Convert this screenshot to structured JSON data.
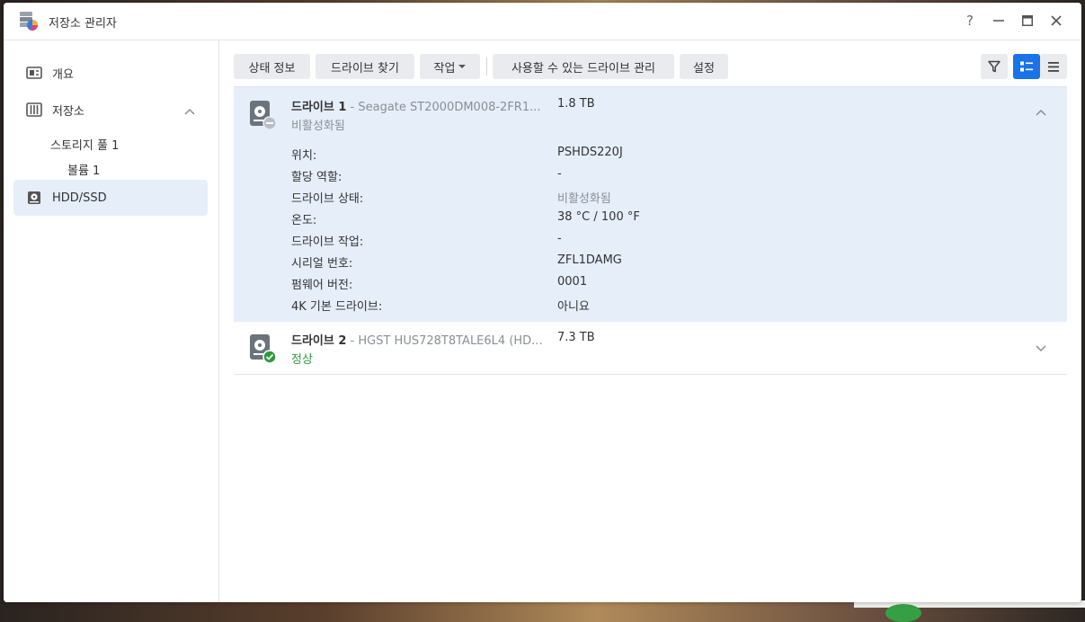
{
  "window": {
    "title": "저장소 관리자",
    "controls": {
      "help": "?",
      "minimize": "—",
      "maximize": "▭",
      "close": "✕"
    }
  },
  "sidebar": {
    "items": [
      {
        "label": "개요",
        "icon": "overview-icon"
      },
      {
        "label": "저장소",
        "icon": "storage-icon"
      },
      {
        "label": "HDD/SSD",
        "icon": "hdd-icon"
      }
    ],
    "sub_items": [
      {
        "label": "스토리지 풀 1"
      },
      {
        "label": "볼륨 1"
      }
    ]
  },
  "toolbar": {
    "status_info": "상태 정보",
    "find_drive": "드라이브 찾기",
    "action": "작업",
    "manage_available": "사용할 수 있는 드라이브 관리",
    "settings": "설정"
  },
  "drives": [
    {
      "name": "드라이브 1",
      "model": " - Seagate ST2000DM008-2FR1...",
      "size": "1.8 TB",
      "status": "비활성화됨",
      "details": [
        {
          "label": "위치:",
          "value": "PSHDS220J"
        },
        {
          "label": "할당 역할:",
          "value": "-"
        },
        {
          "label": "드라이브 상태:",
          "value": "비활성화됨"
        },
        {
          "label": "온도:",
          "value": "38 °C / 100 °F"
        },
        {
          "label": "드라이브 작업:",
          "value": "-"
        },
        {
          "label": "시리얼 번호:",
          "value": "ZFL1DAMG"
        },
        {
          "label": "펌웨어 버전:",
          "value": "0001"
        },
        {
          "label": "4K 기본 드라이브:",
          "value": "아니요"
        }
      ]
    },
    {
      "name": "드라이브 2",
      "model": " - HGST HUS728T8TALE6L4 (HD...",
      "size": "7.3 TB",
      "status": "정상"
    }
  ],
  "colors": {
    "accent": "#1a73e8",
    "selected_bg": "#e6eefa",
    "status_ok": "#2e9a3a",
    "status_disabled": "#8a8f96"
  }
}
